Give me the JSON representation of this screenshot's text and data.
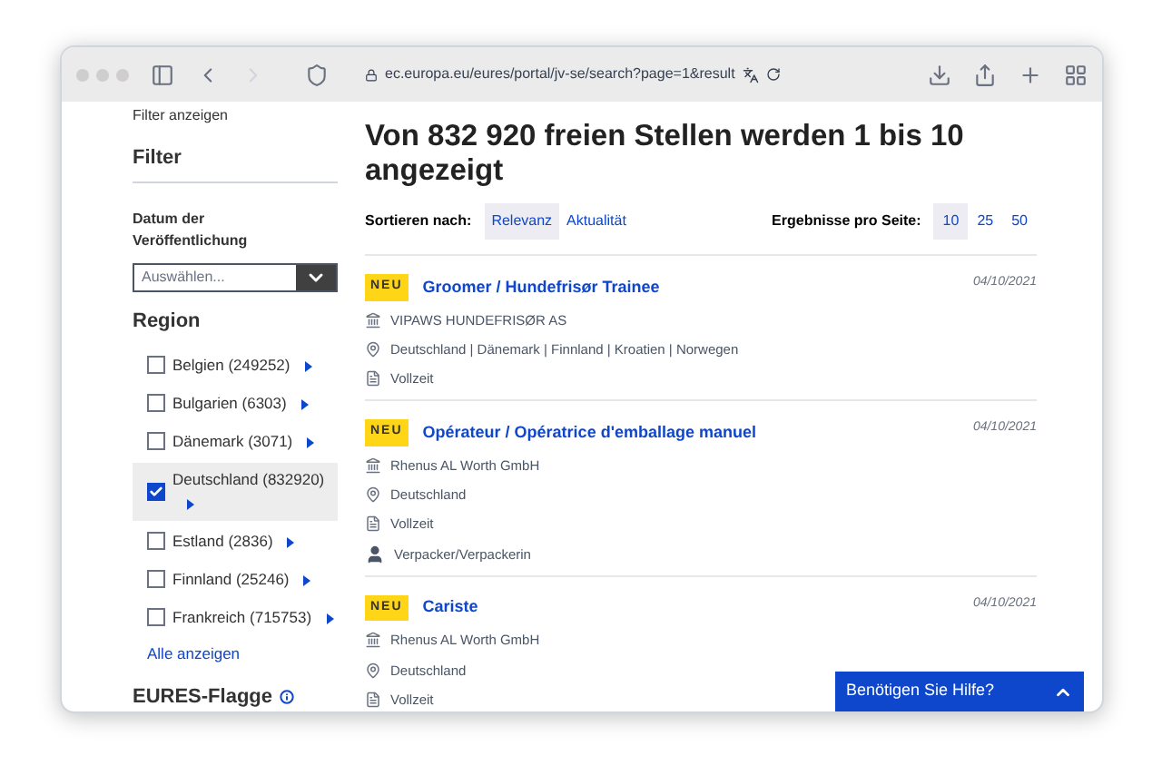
{
  "browser": {
    "url": "ec.europa.eu/eures/portal/jv-se/search?page=1&result"
  },
  "sidebar": {
    "toggle": "Filter anzeigen",
    "title": "Filter",
    "date_label": "Datum der Veröffentlichung",
    "date_select": {
      "placeholder": "Auswählen..."
    },
    "region_title": "Region",
    "regions": [
      {
        "label": "Belgien (249252)",
        "checked": false
      },
      {
        "label": "Bulgarien (6303)",
        "checked": false
      },
      {
        "label": "Dänemark (3071)",
        "checked": false
      },
      {
        "label": "Deutschland (832920)",
        "checked": true
      },
      {
        "label": "Estland (2836)",
        "checked": false
      },
      {
        "label": "Finnland (25246)",
        "checked": false
      },
      {
        "label": "Frankreich (715753)",
        "checked": false
      }
    ],
    "show_all": "Alle anzeigen",
    "flag_title": "EURES-Flagge"
  },
  "main": {
    "heading": "Von 832 920 freien Stellen werden 1 bis 10 angezeigt",
    "sort_label": "Sortieren nach:",
    "sort_options": [
      {
        "label": "Relevanz",
        "selected": true
      },
      {
        "label": "Aktualität",
        "selected": false
      }
    ],
    "per_page_label": "Ergebnisse pro Seite:",
    "per_page_options": [
      {
        "label": "10",
        "selected": true
      },
      {
        "label": "25",
        "selected": false
      },
      {
        "label": "50",
        "selected": false
      }
    ],
    "jobs": [
      {
        "badge": "NEU",
        "title": "Groomer / Hundefrisør Trainee",
        "date": "04/10/2021",
        "details": [
          {
            "kind": "company",
            "text": "VIPAWS HUNDEFRISØR AS"
          },
          {
            "kind": "location",
            "text": "Deutschland | Dänemark | Finnland | Kroatien | Norwegen"
          },
          {
            "kind": "hours",
            "text": "Vollzeit"
          }
        ]
      },
      {
        "badge": "NEU",
        "title": "Opérateur / Opératrice d'emballage manuel",
        "date": "04/10/2021",
        "details": [
          {
            "kind": "company",
            "text": "Rhenus AL Worth GmbH"
          },
          {
            "kind": "location",
            "text": "Deutschland"
          },
          {
            "kind": "hours",
            "text": "Vollzeit"
          },
          {
            "kind": "occupation",
            "text": "Verpacker/Verpackerin"
          }
        ]
      },
      {
        "badge": "NEU",
        "title": "Cariste",
        "date": "04/10/2021",
        "details": [
          {
            "kind": "company",
            "text": "Rhenus AL Worth GmbH"
          },
          {
            "kind": "location",
            "text": "Deutschland"
          },
          {
            "kind": "hours",
            "text": "Vollzeit"
          }
        ]
      }
    ]
  },
  "help": {
    "label": "Benötigen Sie Hilfe?"
  }
}
